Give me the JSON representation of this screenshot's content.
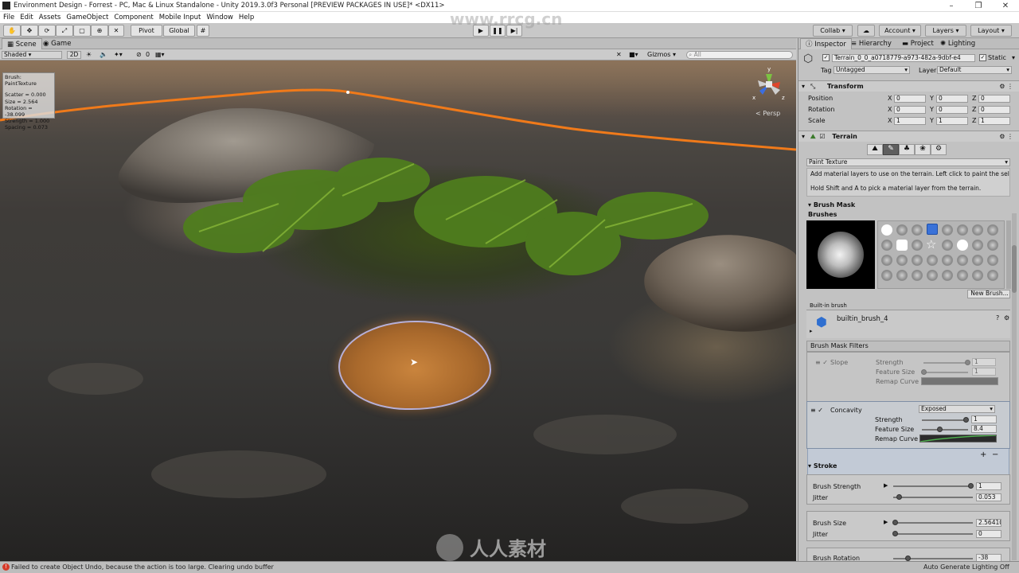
{
  "window": {
    "title": "Environment Design - Forrest - PC, Mac & Linux Standalone - Unity 2019.3.0f3 Personal [PREVIEW PACKAGES IN USE]* <DX11>"
  },
  "menu": [
    "File",
    "Edit",
    "Assets",
    "GameObject",
    "Component",
    "Mobile Input",
    "Window",
    "Help"
  ],
  "toolbar": {
    "pivot": "Pivot",
    "global": "Global",
    "collab": "Collab ▾",
    "account": "Account ▾",
    "layers": "Layers ▾",
    "layout": "Layout ▾"
  },
  "scene": {
    "tabs": [
      "Scene",
      "Game"
    ],
    "shading": "Shaded",
    "mode_2d": "2D",
    "gizmo_count": "0",
    "gizmos": "Gizmos",
    "search_placeholder": "All",
    "persp_label": "< Persp",
    "brush_info": [
      "Brush: PaintTexture",
      "Scatter = 0.000",
      "Size = 2.564",
      "Rotation = -38.099",
      "Strength = 1.000",
      "Spacing = 0.073"
    ]
  },
  "inspector": {
    "tabs": [
      "Inspector",
      "Hierarchy",
      "Project",
      "Lighting"
    ],
    "object_name": "Terrain_0_0_a0718779-a973-482a-9dbf-e4",
    "static_label": "Static",
    "tag_label": "Tag",
    "tag_value": "Untagged",
    "layer_label": "Layer",
    "layer_value": "Default",
    "transform": {
      "title": "Transform",
      "rows": [
        {
          "label": "Position",
          "x": "0",
          "y": "0",
          "z": "0"
        },
        {
          "label": "Rotation",
          "x": "0",
          "y": "0",
          "z": "0"
        },
        {
          "label": "Scale",
          "x": "1",
          "y": "1",
          "z": "1"
        }
      ],
      "axis": [
        "X",
        "Y",
        "Z"
      ]
    },
    "terrain": {
      "title": "Terrain",
      "tool": "Paint Texture",
      "help1": "Add material layers to use on the terrain. Left click to paint the sele",
      "help2": "Hold Shift and A to pick a material layer from the terrain.",
      "brush_mask": "Brush Mask",
      "brushes": "Brushes",
      "new_brush": "New Brush...",
      "builtin_label": "Built-in brush",
      "brush_name": "builtin_brush_4",
      "filters_title": "Brush Mask Filters",
      "slope": {
        "name": "Slope",
        "strength_label": "Strength",
        "strength": "1",
        "feature_label": "Feature Size",
        "feature": "1",
        "remap_label": "Remap Curve"
      },
      "concavity": {
        "name": "Concavity",
        "mode": "Exposed",
        "strength_label": "Strength",
        "strength": "1",
        "feature_label": "Feature Size",
        "feature": "8.4",
        "remap_label": "Remap Curve"
      },
      "stroke_title": "Stroke",
      "brush_strength_label": "Brush Strength",
      "brush_strength": "1",
      "jitter_label": "Jitter",
      "jitter1": "0.053",
      "brush_size_label": "Brush Size",
      "brush_size": "2.56410",
      "jitter2": "0",
      "brush_rotation_label": "Brush Rotation",
      "brush_rotation": "-38"
    }
  },
  "status": {
    "message": "Failed to create Object Undo, because the action is too large. Clearing undo buffer",
    "lighting": "Auto Generate Lighting Off"
  },
  "watermark": {
    "site": "www.rrcg.cn",
    "brand": "人人素材"
  },
  "colors": {
    "accent": "#f07a1a",
    "selection_blue": "#3a72d8",
    "paint": "#b7752f"
  }
}
